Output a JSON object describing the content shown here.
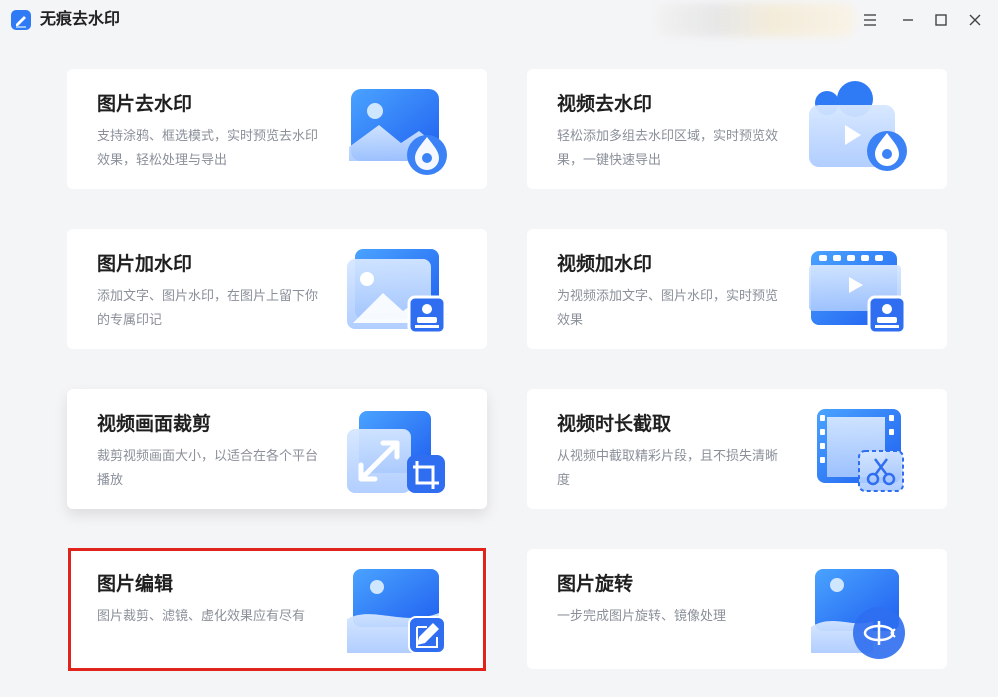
{
  "app": {
    "title": "无痕去水印",
    "logo_icon": "app-logo-icon"
  },
  "window_controls": [
    "menu-icon",
    "minimize-icon",
    "maximize-icon",
    "close-icon"
  ],
  "colors": {
    "accent": "#2f7bf6",
    "highlight_border": "#e0241b",
    "background": "#f4f5f7"
  },
  "cards": [
    {
      "title": "图片去水印",
      "desc": "支持涂鸦、框选模式，实时预览去水印效果，轻松处理与导出",
      "icon": "image-remove-watermark-icon"
    },
    {
      "title": "视频去水印",
      "desc": "轻松添加多组去水印区域，实时预览效果，一键快速导出",
      "icon": "video-remove-watermark-icon"
    },
    {
      "title": "图片加水印",
      "desc": "添加文字、图片水印，在图片上留下你的专属印记",
      "icon": "image-add-watermark-icon"
    },
    {
      "title": "视频加水印",
      "desc": "为视频添加文字、图片水印，实时预览效果",
      "icon": "video-add-watermark-icon"
    },
    {
      "title": "视频画面裁剪",
      "desc": "裁剪视频画面大小，以适合在各个平台播放",
      "icon": "video-crop-icon"
    },
    {
      "title": "视频时长截取",
      "desc": "从视频中截取精彩片段，且不损失清晰度",
      "icon": "video-trim-icon"
    },
    {
      "title": "图片编辑",
      "desc": "图片裁剪、滤镜、虚化效果应有尽有",
      "icon": "image-edit-icon"
    },
    {
      "title": "图片旋转",
      "desc": "一步完成图片旋转、镜像处理",
      "icon": "image-rotate-icon"
    }
  ]
}
